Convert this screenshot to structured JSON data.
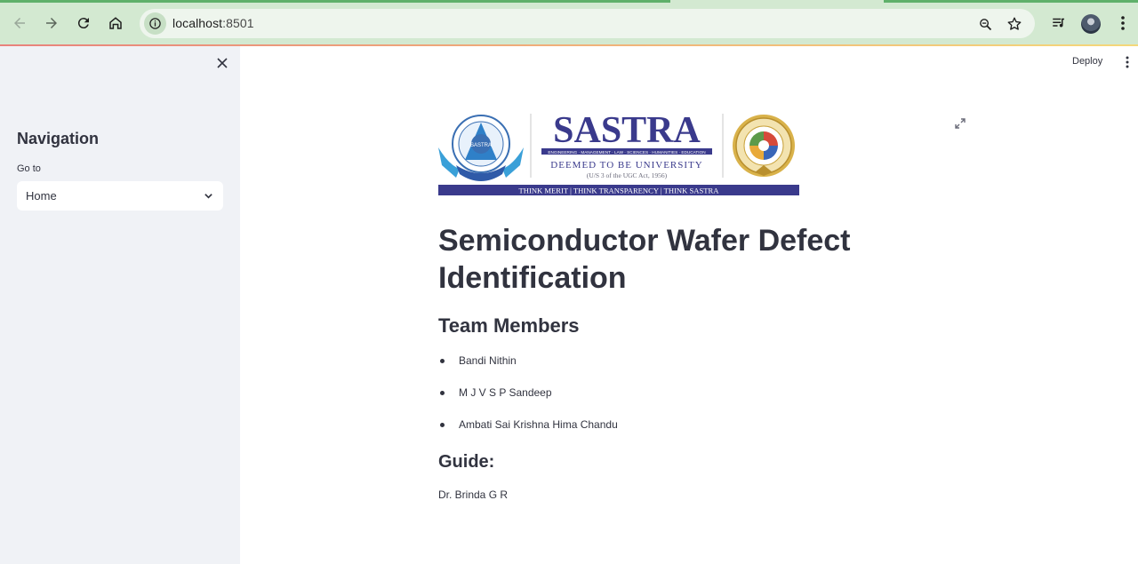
{
  "browser": {
    "url_host": "localhost",
    "url_port": ":8501",
    "icons": [
      "back-icon",
      "forward-icon",
      "reload-icon",
      "home-icon",
      "site-info-icon",
      "zoom-icon",
      "bookmark-star-icon",
      "media-icon",
      "profile-avatar",
      "menu-icon"
    ]
  },
  "sidebar": {
    "title": "Navigation",
    "goto_label": "Go to",
    "select_value": "Home"
  },
  "toolbar": {
    "deploy_label": "Deploy"
  },
  "logo": {
    "name": "SASTRA",
    "tagline": "ENGINEERING · MANAGEMENT · LAW · SCIENCES · HUMANITIES · EDUCATION",
    "deemed": "DEEMED TO BE UNIVERSITY",
    "act": "(U/S 3 of the UGC Act, 1956)",
    "motto": "THINK MERIT  |  THINK TRANSPARENCY  |  THINK SASTRA",
    "emblem_text": "SASTRA"
  },
  "main": {
    "title": "Semiconductor Wafer Defect Identification",
    "team_heading": "Team Members",
    "members": [
      "Bandi Nithin",
      "M J V S P Sandeep",
      "Ambati Sai Krishna Hima Chandu"
    ],
    "guide_heading": "Guide:",
    "guide_name": "Dr. Brinda G R"
  },
  "colors": {
    "chrome": "#d3e9d1",
    "sidebar": "#f0f2f6",
    "text": "#31333f",
    "logo_blue": "#3a3a8c",
    "logo_gold": "#c9a23c"
  }
}
